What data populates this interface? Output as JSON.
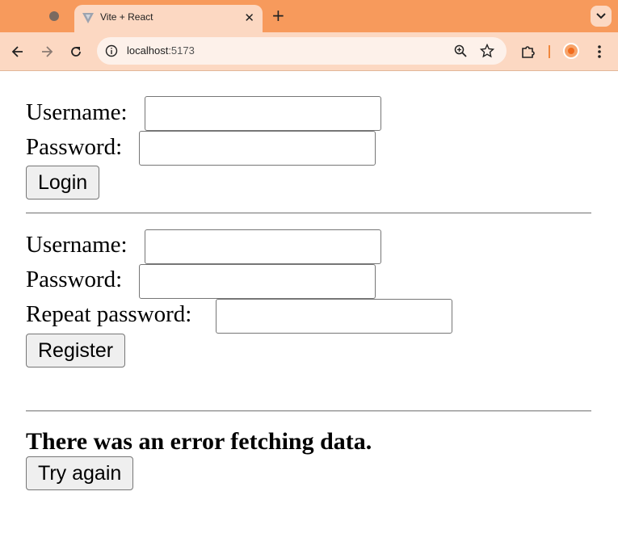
{
  "browser": {
    "tab": {
      "title": "Vite + React"
    },
    "address": {
      "host": "localhost",
      "port": ":5173"
    }
  },
  "login_form": {
    "username_label": "Username:",
    "password_label": "Password:",
    "username_value": "",
    "password_value": "",
    "submit_label": "Login"
  },
  "register_form": {
    "username_label": "Username:",
    "password_label": "Password:",
    "repeat_password_label": "Repeat password:",
    "username_value": "",
    "password_value": "",
    "repeat_password_value": "",
    "submit_label": "Register"
  },
  "error_panel": {
    "message": "There was an error fetching data.",
    "retry_label": "Try again"
  },
  "theme": {
    "tabbar_color": "#f79a5c",
    "toolbar_color": "#fcd8c2",
    "icons": [
      "vite-logo-icon",
      "close-icon",
      "plus-icon",
      "chevron-down-icon",
      "back-icon",
      "forward-icon",
      "reload-icon",
      "site-info-icon",
      "zoom-icon",
      "star-icon",
      "extensions-icon",
      "profile-avatar-icon",
      "more-menu-icon"
    ]
  }
}
